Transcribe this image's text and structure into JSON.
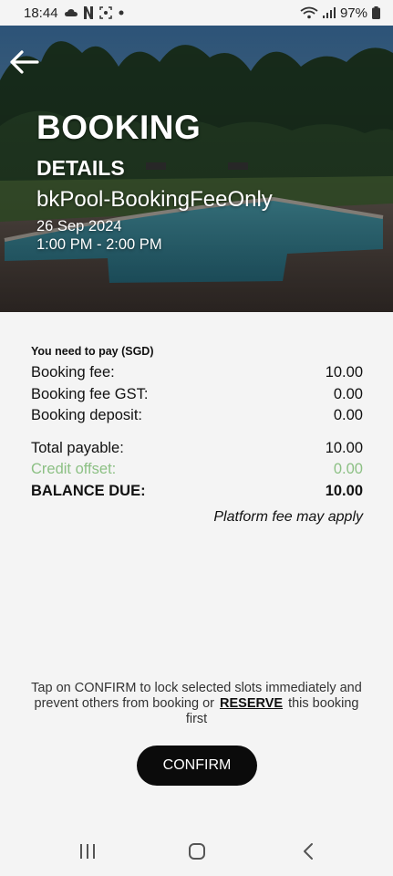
{
  "status_bar": {
    "time": "18:44",
    "battery": "97%",
    "icons": [
      "cloud-icon",
      "netflix-icon",
      "screenshot-icon",
      "dot-icon",
      "wifi-icon",
      "signal-icon",
      "battery-icon"
    ]
  },
  "hero": {
    "title": "BOOKING",
    "subtitle": "DETAILS",
    "facility": "bkPool-BookingFeeOnly",
    "date": "26 Sep 2024",
    "time": "1:00 PM - 2:00 PM"
  },
  "payment": {
    "header": "You need to pay (SGD)",
    "rows": [
      {
        "label": "Booking fee:",
        "value": "10.00"
      },
      {
        "label": "Booking fee GST:",
        "value": "0.00"
      },
      {
        "label": "Booking deposit:",
        "value": "0.00"
      },
      {
        "label": "Total payable:",
        "value": "10.00"
      },
      {
        "label": "Credit offset:",
        "value": "0.00"
      },
      {
        "label": "BALANCE DUE:",
        "value": "10.00"
      }
    ],
    "note": "Platform fee may apply"
  },
  "confirm_note": {
    "before": "Tap on CONFIRM to lock selected slots immediately and prevent others from booking or",
    "link": "RESERVE",
    "after": "this booking first"
  },
  "confirm_button": "CONFIRM",
  "colors": {
    "credit": "#8cc084",
    "button": "#0b0b0b",
    "background": "#f4f4f4"
  }
}
